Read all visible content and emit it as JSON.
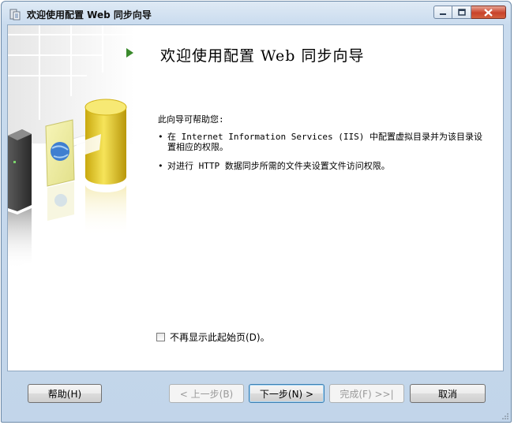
{
  "window": {
    "title": "欢迎使用配置 Web 同步向导"
  },
  "page": {
    "heading": "欢迎使用配置 Web 同步向导",
    "intro": "此向导可帮助您:",
    "bullets": [
      "在 Internet Information Services (IIS) 中配置虚拟目录并为该目录设置相应的权限。",
      "对进行 HTTP 数据同步所需的文件夹设置文件访问权限。"
    ],
    "bullet_mark": "•",
    "checkbox": {
      "label": "不再显示此起始页(D)。",
      "checked": false
    }
  },
  "buttons": {
    "help": "帮助(H)",
    "prev": "< 上一步(B)",
    "next": "下一步(N) >",
    "finish": "完成(F) >>|",
    "cancel": "取消"
  },
  "colors": {
    "accent_arrow": "#3a8a2c",
    "cylinder": "#e8cc2a",
    "close_button": "#c8432b"
  },
  "icons": [
    "wizard-icon",
    "minimize-icon",
    "maximize-icon",
    "close-icon",
    "arrow-right-icon",
    "database-icon",
    "server-icon",
    "globe-icon",
    "size-grip-icon"
  ]
}
